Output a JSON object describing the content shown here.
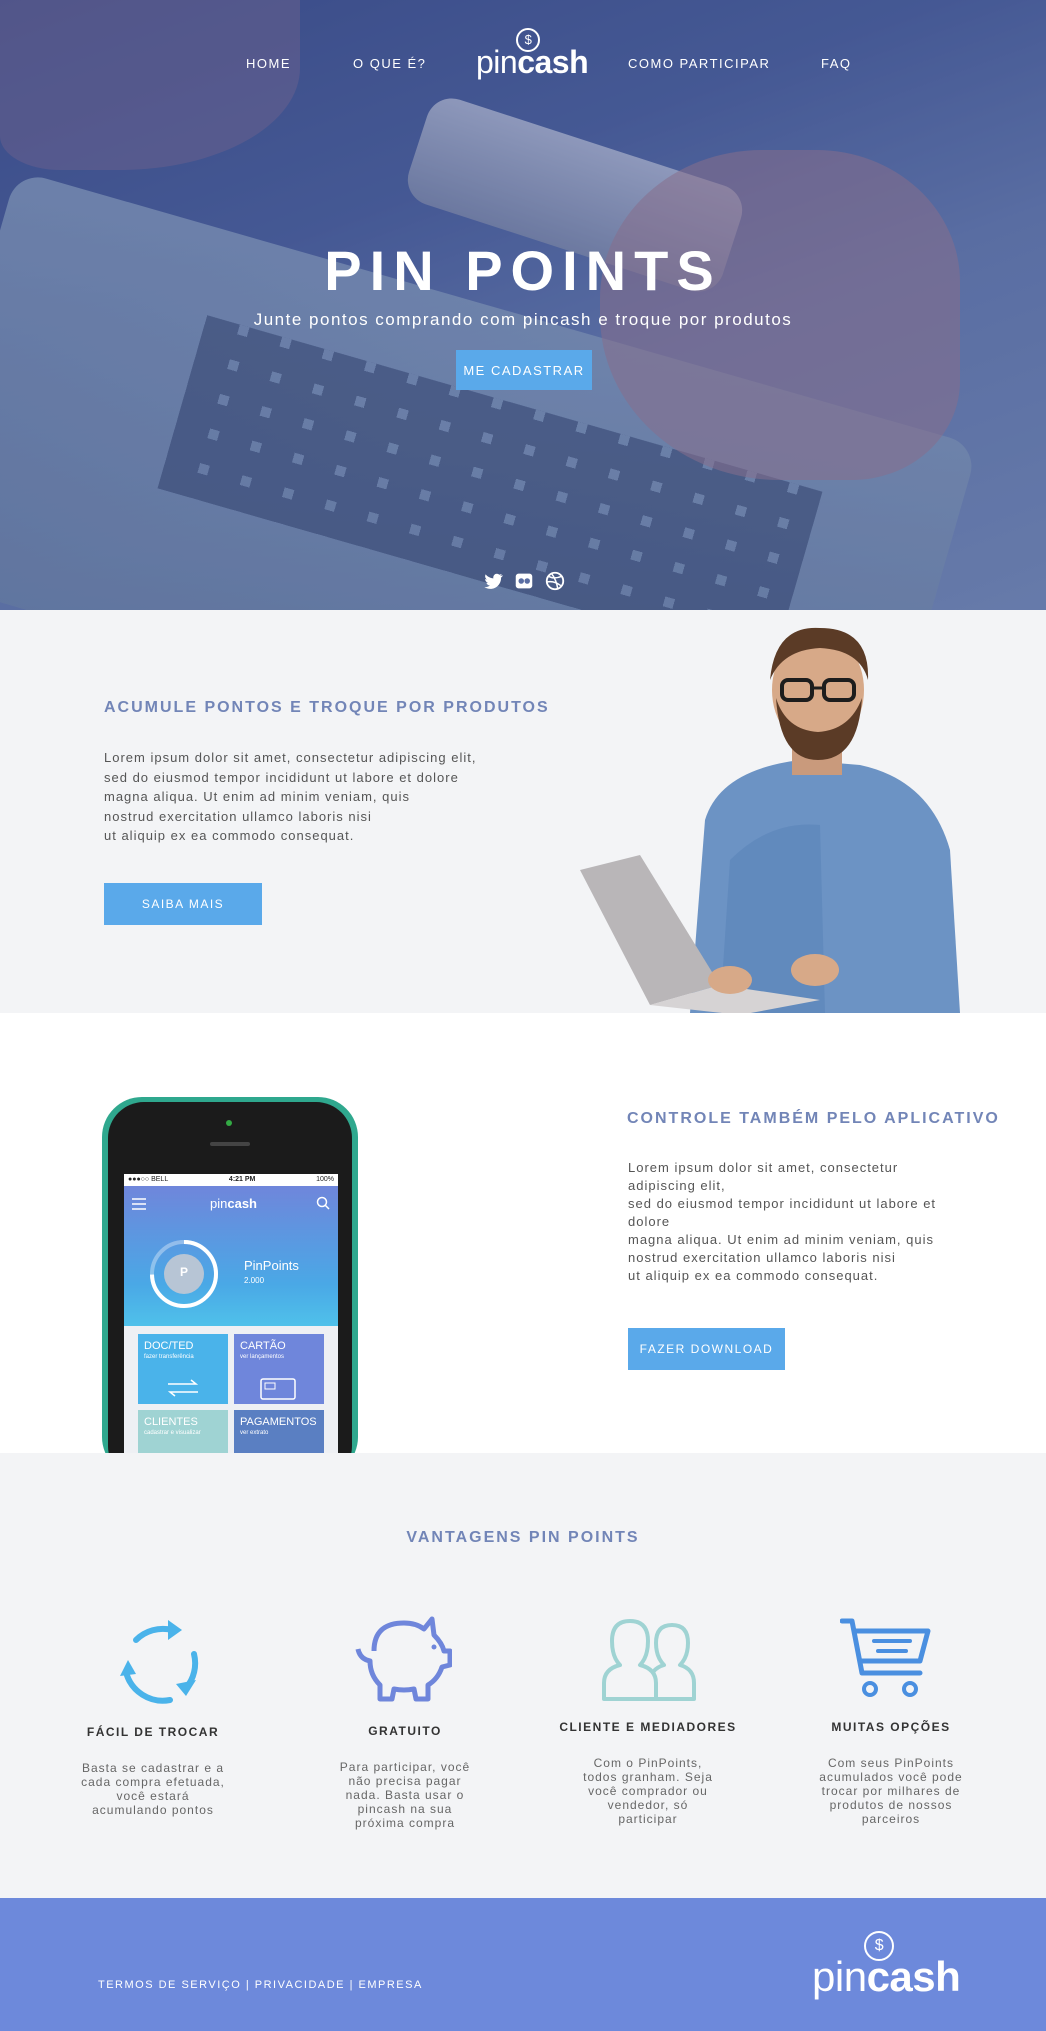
{
  "nav": {
    "home": "HOME",
    "o_que_e": "O QUE É?",
    "como_participar": "COMO PARTICIPAR",
    "faq": "FAQ"
  },
  "logo": {
    "light": "pin",
    "bold": "cash",
    "coin": "$"
  },
  "hero": {
    "title": "PIN POINTS",
    "subtitle": "Junte pontos comprando com pincash e troque por produtos",
    "button": "ME CADASTRAR",
    "social_icons": [
      "twitter-icon",
      "flickr-icon",
      "dribbble-icon"
    ]
  },
  "acumule": {
    "title": "ACUMULE PONTOS E TROQUE POR PRODUTOS",
    "lines": [
      "Lorem ipsum dolor sit amet, consectetur adipiscing elit,",
      "sed do eiusmod tempor incididunt ut labore et dolore",
      "magna aliqua. Ut enim ad minim veniam, quis",
      "nostrud exercitation ullamco laboris nisi",
      "ut aliquip ex ea commodo consequat."
    ],
    "button": "SAIBA MAIS"
  },
  "app": {
    "title": "CONTROLE TAMBÉM PELO APLICATIVO",
    "lines": [
      "Lorem ipsum dolor sit amet, consectetur",
      "adipiscing elit,",
      "sed do eiusmod tempor incididunt ut labore et",
      "dolore",
      "magna aliqua. Ut enim ad minim veniam, quis",
      "nostrud exercitation ullamco laboris nisi",
      "ut aliquip ex ea commodo consequat."
    ],
    "button": "FAZER DOWNLOAD",
    "phone": {
      "carrier": "●●●○○ BELL",
      "time": "4:21 PM",
      "battery": "100%",
      "logo_light": "pin",
      "logo_bold": "cash",
      "points_label": "PinPoints",
      "points_value": "2.000",
      "badge": "P",
      "tiles": [
        {
          "title": "DOC/TED",
          "sub": "fazer transferência",
          "color": "#4ab3ea"
        },
        {
          "title": "CARTÃO",
          "sub": "ver lançamentos",
          "color": "#6f86db"
        },
        {
          "title": "CLIENTES",
          "sub": "cadastrar e visualizar",
          "color": "#9fd3d3"
        },
        {
          "title": "PAGAMENTOS",
          "sub": "ver extrato",
          "color": "#5a7fc2"
        }
      ]
    }
  },
  "vantagens": {
    "title": "VANTAGENS PIN POINTS",
    "features": [
      {
        "title": "FÁCIL DE TROCAR",
        "lines": [
          "Basta se cadastrar e a",
          "cada compra efetuada,",
          "você estará",
          "acumulando pontos"
        ],
        "icon": "refresh-icon",
        "color": "#4ab3ea"
      },
      {
        "title": "GRATUITO",
        "lines": [
          "Para participar, você",
          "não precisa pagar",
          "nada. Basta usar o",
          "pincash na sua",
          "próxima compra"
        ],
        "icon": "piggy-bank-icon",
        "color": "#6f86db"
      },
      {
        "title": "CLIENTE E MEDIADORES",
        "lines": [
          "Com o PinPoints,",
          "todos granham. Seja",
          "você comprador ou",
          "vendedor, só",
          "participar"
        ],
        "icon": "users-icon",
        "color": "#9fd3d3"
      },
      {
        "title": "MUITAS OPÇÕES",
        "lines": [
          "Com seus PinPoints",
          "acumulados você pode",
          "trocar por milhares de",
          "produtos de nossos",
          "parceiros"
        ],
        "icon": "cart-icon",
        "color": "#4a8fe0"
      }
    ]
  },
  "footer": {
    "links": [
      "TERMOS DE SERVIÇO",
      "PRIVACIDADE",
      "EMPRESA"
    ],
    "separator": "|",
    "logo_light": "pin",
    "logo_bold": "cash",
    "logo_coin": "$"
  }
}
